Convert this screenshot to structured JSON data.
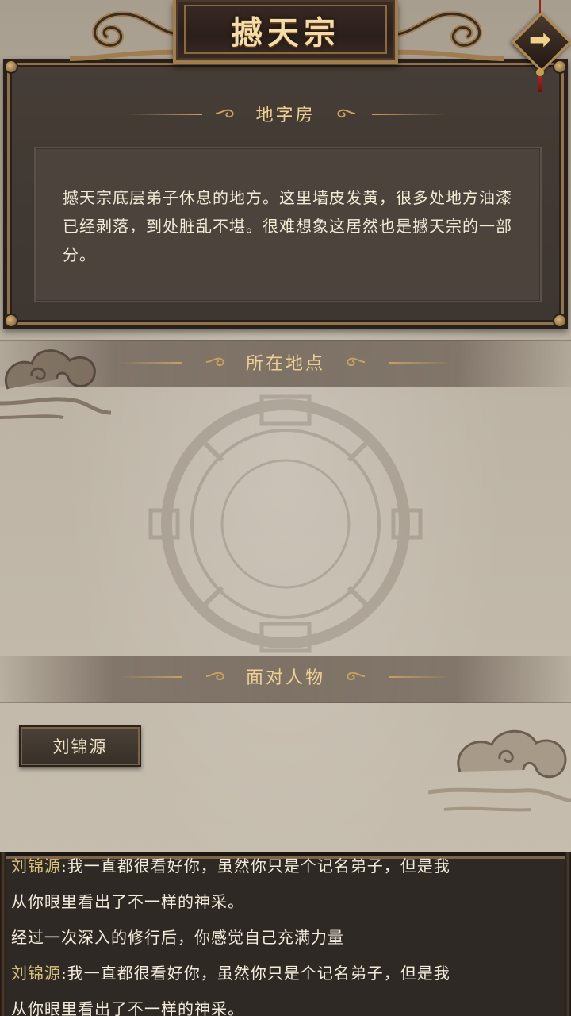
{
  "header": {
    "title": "撼天宗",
    "next_icon": "right-arrow-icon",
    "next_symbol": "➡"
  },
  "room": {
    "heading": "地字房",
    "description": "撼天宗底层弟子休息的地方。这里墙皮发黄，很多处地方油漆已经剥落，到处脏乱不堪。很难想象这居然也是撼天宗的一部分。"
  },
  "location": {
    "heading": "所在地点"
  },
  "characters": {
    "heading": "面对人物",
    "items": [
      {
        "name": "刘锦源"
      }
    ]
  },
  "log": {
    "lines": [
      {
        "speaker": "刘锦源",
        "text": ":我一直都很看好你，虽然你只是个记名弟子，但是我"
      },
      {
        "speaker": "",
        "text": "从你眼里看出了不一样的神采。"
      },
      {
        "speaker": "",
        "text": "经过一次深入的修行后，你感觉自己充满力量"
      },
      {
        "speaker": "刘锦源",
        "text": ":我一直都很看好你，虽然你只是个记名弟子，但是我"
      },
      {
        "speaker": "",
        "text": "从你眼里看出了不一样的神采。"
      }
    ]
  },
  "colors": {
    "gold_text": "#efcf93",
    "panel_dark": "#3d3631",
    "speaker": "#d8c27a"
  }
}
